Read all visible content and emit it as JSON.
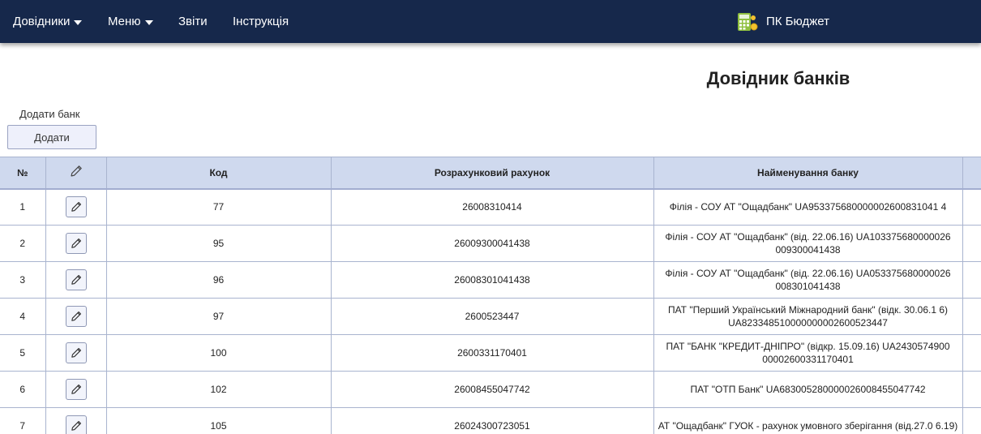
{
  "nav": {
    "dovidnyky": "Довідники",
    "menu": "Меню",
    "zvity": "Звіти",
    "instruktsiia": "Інструкція",
    "brand": "ПК Бюджет"
  },
  "page": {
    "title": "Довідник банків",
    "add_label": "Додати банк",
    "add_button": "Додати"
  },
  "table": {
    "headers": {
      "num": "№",
      "kod": "Код",
      "rakhunok": "Розрахунковий рахунок",
      "bank": "Найменування банку"
    },
    "rows": [
      {
        "num": "1",
        "kod": "77",
        "rakhunok": "26008310414",
        "bank": "Філія - СОУ АТ \"Ощадбанк\" UA953375680000002600831041 4"
      },
      {
        "num": "2",
        "kod": "95",
        "rakhunok": "26009300041438",
        "bank": "Філія - СОУ АТ \"Ощадбанк\" (від. 22.06.16) UA103375680000026 009300041438"
      },
      {
        "num": "3",
        "kod": "96",
        "rakhunok": "26008301041438",
        "bank": "Філія - СОУ АТ \"Ощадбанк\" (від. 22.06.16) UA053375680000026 008301041438"
      },
      {
        "num": "4",
        "kod": "97",
        "rakhunok": "2600523447",
        "bank": "ПАТ \"Перший Український Міжнародний банк\" (відк. 30.06.1 6) UA823348510000000002600523447"
      },
      {
        "num": "5",
        "kod": "100",
        "rakhunok": "2600331170401",
        "bank": "ПАТ \"БАНК \"КРЕДИТ-ДНІПРО\" (відкр. 15.09.16) UA2430574900 00002600331170401"
      },
      {
        "num": "6",
        "kod": "102",
        "rakhunok": "26008455047742",
        "bank": "ПАТ \"ОТП Банк\" UA683005280000026008455047742"
      },
      {
        "num": "7",
        "kod": "105",
        "rakhunok": "26024300723051",
        "bank": "АТ \"Ощадбанк\" ГУОК - рахунок умовного зберігання (від.27.0 6.19)"
      }
    ]
  },
  "icons": {
    "brand": "calculator-coins-icon",
    "edit": "pencil-icon"
  },
  "colors": {
    "navbar": "#16284b",
    "table_header": "#cfd9ee",
    "border": "#a9b4cf"
  }
}
